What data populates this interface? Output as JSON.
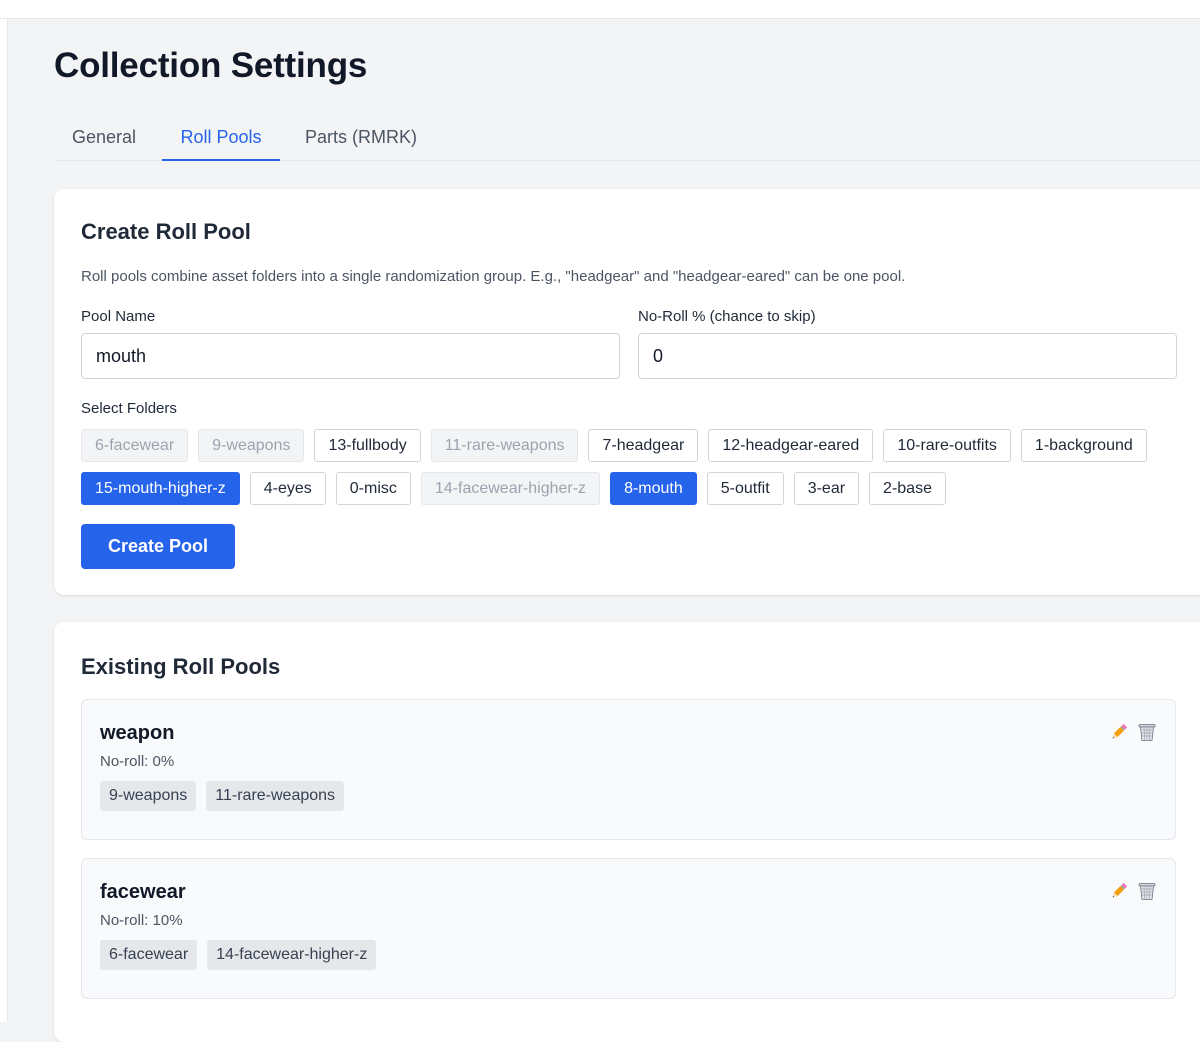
{
  "page": {
    "title": "Collection Settings"
  },
  "tabs": [
    {
      "label": "General",
      "active": false
    },
    {
      "label": "Roll Pools",
      "active": true
    },
    {
      "label": "Parts (RMRK)",
      "active": false
    }
  ],
  "create_card": {
    "title": "Create Roll Pool",
    "description": "Roll pools combine asset folders into a single randomization group. E.g., \"headgear\" and \"headgear-eared\" can be one pool.",
    "pool_name_label": "Pool Name",
    "pool_name_value": "mouth",
    "noroll_label": "No-Roll % (chance to skip)",
    "noroll_value": "0",
    "folders_label": "Select Folders",
    "folders": [
      {
        "label": "6-facewear",
        "state": "disabled"
      },
      {
        "label": "9-weapons",
        "state": "disabled"
      },
      {
        "label": "13-fullbody",
        "state": "normal"
      },
      {
        "label": "11-rare-weapons",
        "state": "disabled"
      },
      {
        "label": "7-headgear",
        "state": "normal"
      },
      {
        "label": "12-headgear-eared",
        "state": "normal"
      },
      {
        "label": "10-rare-outfits",
        "state": "normal"
      },
      {
        "label": "1-background",
        "state": "normal"
      },
      {
        "label": "15-mouth-higher-z",
        "state": "selected"
      },
      {
        "label": "4-eyes",
        "state": "normal"
      },
      {
        "label": "0-misc",
        "state": "normal"
      },
      {
        "label": "14-facewear-higher-z",
        "state": "disabled"
      },
      {
        "label": "8-mouth",
        "state": "selected"
      },
      {
        "label": "5-outfit",
        "state": "normal"
      },
      {
        "label": "3-ear",
        "state": "normal"
      },
      {
        "label": "2-base",
        "state": "normal"
      }
    ],
    "create_button": "Create Pool"
  },
  "existing_card": {
    "title": "Existing Roll Pools",
    "pools": [
      {
        "name": "weapon",
        "noroll": "No-roll: 0%",
        "folders": [
          "9-weapons",
          "11-rare-weapons"
        ]
      },
      {
        "name": "facewear",
        "noroll": "No-roll: 10%",
        "folders": [
          "6-facewear",
          "14-facewear-higher-z"
        ]
      }
    ]
  },
  "icons": {
    "edit": "pencil-icon",
    "delete": "trash-icon"
  },
  "colors": {
    "accent": "#2563eb",
    "chip_disabled_bg": "#f3f4f6",
    "tag_bg": "#e5e7eb"
  }
}
